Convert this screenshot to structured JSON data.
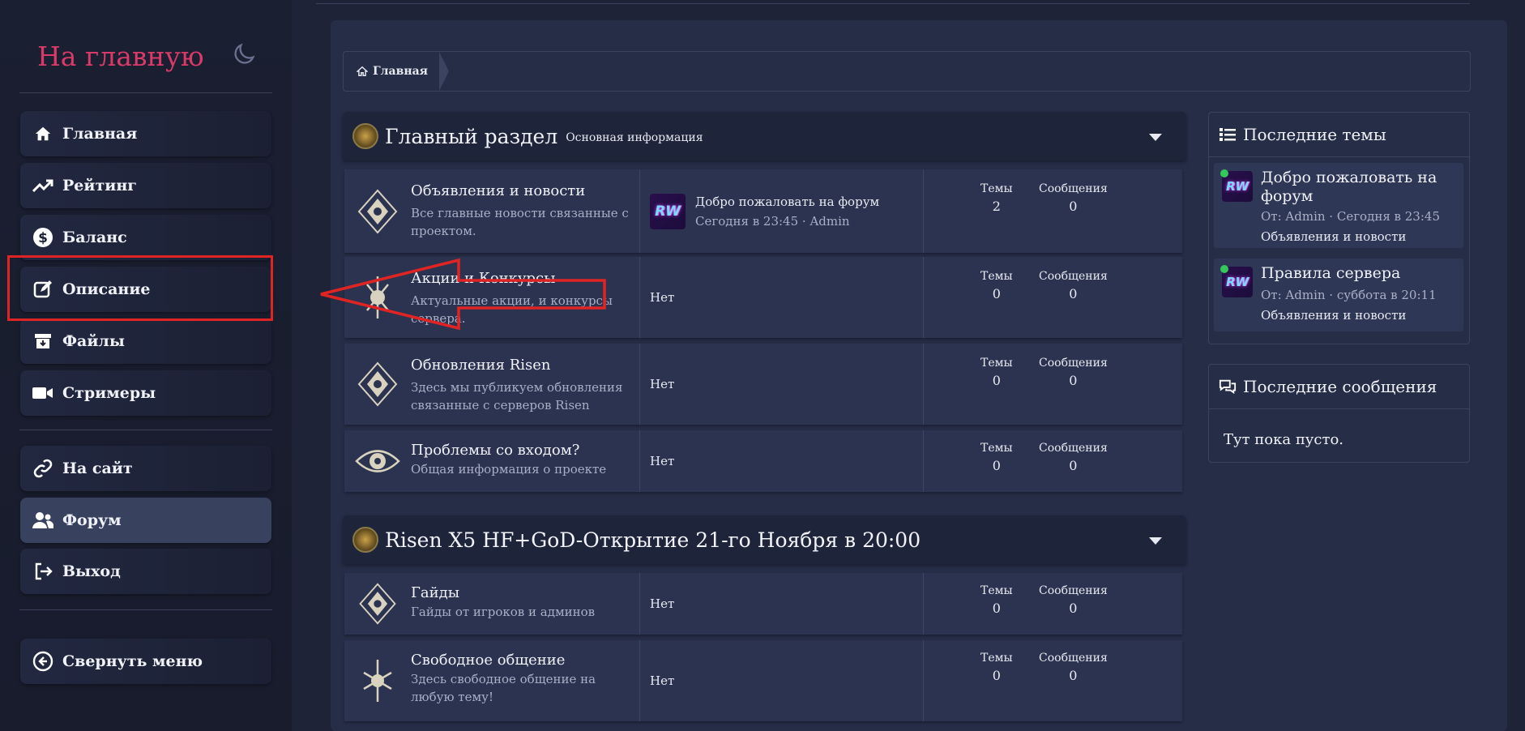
{
  "sidebar": {
    "brand": "На главную",
    "items": [
      {
        "label": "Главная",
        "icon": "home-icon"
      },
      {
        "label": "Рейтинг",
        "icon": "trending-up-icon"
      },
      {
        "label": "Баланс",
        "icon": "dollar-circle-icon"
      },
      {
        "label": "Описание",
        "icon": "edit-icon"
      },
      {
        "label": "Файлы",
        "icon": "archive-icon"
      },
      {
        "label": "Стримеры",
        "icon": "video-camera-icon"
      },
      {
        "label": "На сайт",
        "icon": "link-icon"
      },
      {
        "label": "Форум",
        "icon": "users-icon"
      },
      {
        "label": "Выход",
        "icon": "sign-out-icon"
      },
      {
        "label": "Свернуть меню",
        "icon": "arrow-circle-left-icon"
      }
    ]
  },
  "breadcrumb": {
    "home": "Главная"
  },
  "sections": [
    {
      "title": "Главный раздел",
      "subtitle": "Основная информация",
      "forums": [
        {
          "title": "Объявления и новости",
          "desc": "Все главные новости связанные с проектом.",
          "last_title": "Добро пожаловать на форум",
          "last_meta": "Сегодня в 23:45 · Admin",
          "none": "",
          "topics": "2",
          "posts": "0"
        },
        {
          "title": "Акции и Конкурсы",
          "desc": "Актуальные акции, и конкурсы сервера.",
          "last_title": "",
          "last_meta": "",
          "none": "Нет",
          "topics": "0",
          "posts": "0"
        },
        {
          "title": "Обновления Risen",
          "desc": "Здесь мы публикуем обновления связанные с серверов Risen",
          "last_title": "",
          "last_meta": "",
          "none": "Нет",
          "topics": "0",
          "posts": "0"
        },
        {
          "title": "Проблемы со входом?",
          "desc": "Общая информация о проекте",
          "last_title": "",
          "last_meta": "",
          "none": "Нет",
          "topics": "0",
          "posts": "0"
        }
      ]
    },
    {
      "title": "Risen X5 HF+GoD-Открытие 21-го Ноября в 20:00",
      "subtitle": "",
      "forums": [
        {
          "title": "Гайды",
          "desc": "Гайды от игроков и админов",
          "none": "Нет",
          "topics": "0",
          "posts": "0"
        },
        {
          "title": "Свободное общение",
          "desc": "Здесь свободное общение на любую тему!",
          "none": "Нет",
          "topics": "0",
          "posts": "0"
        }
      ]
    }
  ],
  "stats_labels": {
    "topics": "Темы",
    "posts": "Сообщения"
  },
  "avatar_text": "RW",
  "latest_topics": {
    "title": "Последние темы",
    "items": [
      {
        "title": "Добро пожаловать на форум",
        "meta": "От: Admin · Сегодня в 23:45",
        "forum": "Объявления и новости"
      },
      {
        "title": "Правила сервера",
        "meta": "От: Admin · суббота в 20:11",
        "forum": "Объявления и новости"
      }
    ]
  },
  "latest_posts": {
    "title": "Последние сообщения",
    "empty": "Тут пока пусто."
  },
  "colors": {
    "accent": "#d93a6a",
    "annotation": "#e02424",
    "online": "#34c759"
  }
}
